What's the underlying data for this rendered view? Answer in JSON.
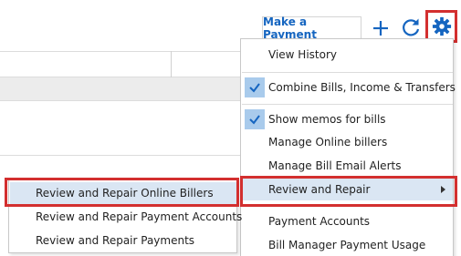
{
  "toolbar": {
    "make_payment_label": "Make a Payment",
    "plus_icon": "plus-icon",
    "refresh_icon": "refresh-icon",
    "gear_icon": "gear-icon"
  },
  "menu": {
    "items": [
      {
        "label": "View History"
      },
      {
        "label": "Combine Bills, Income & Transfers",
        "checked": true
      },
      {
        "label": "Show memos for bills",
        "checked": true
      },
      {
        "label": "Manage Online billers"
      },
      {
        "label": "Manage Bill Email Alerts"
      },
      {
        "label": "Review and Repair",
        "highlighted": true,
        "has_submenu": true
      },
      {
        "label": "Payment Accounts"
      },
      {
        "label": "Bill Manager Payment Usage"
      }
    ]
  },
  "submenu": {
    "items": [
      {
        "label": "Review and Repair Online Billers",
        "highlighted": true
      },
      {
        "label": "Review and Repair Payment Accounts"
      },
      {
        "label": "Review and Repair Payments"
      }
    ]
  },
  "colors": {
    "accent_blue": "#1565c0",
    "highlight_red": "#d32f2f",
    "menu_hover": "#dae6f3",
    "check_bg": "#a9cbec"
  }
}
